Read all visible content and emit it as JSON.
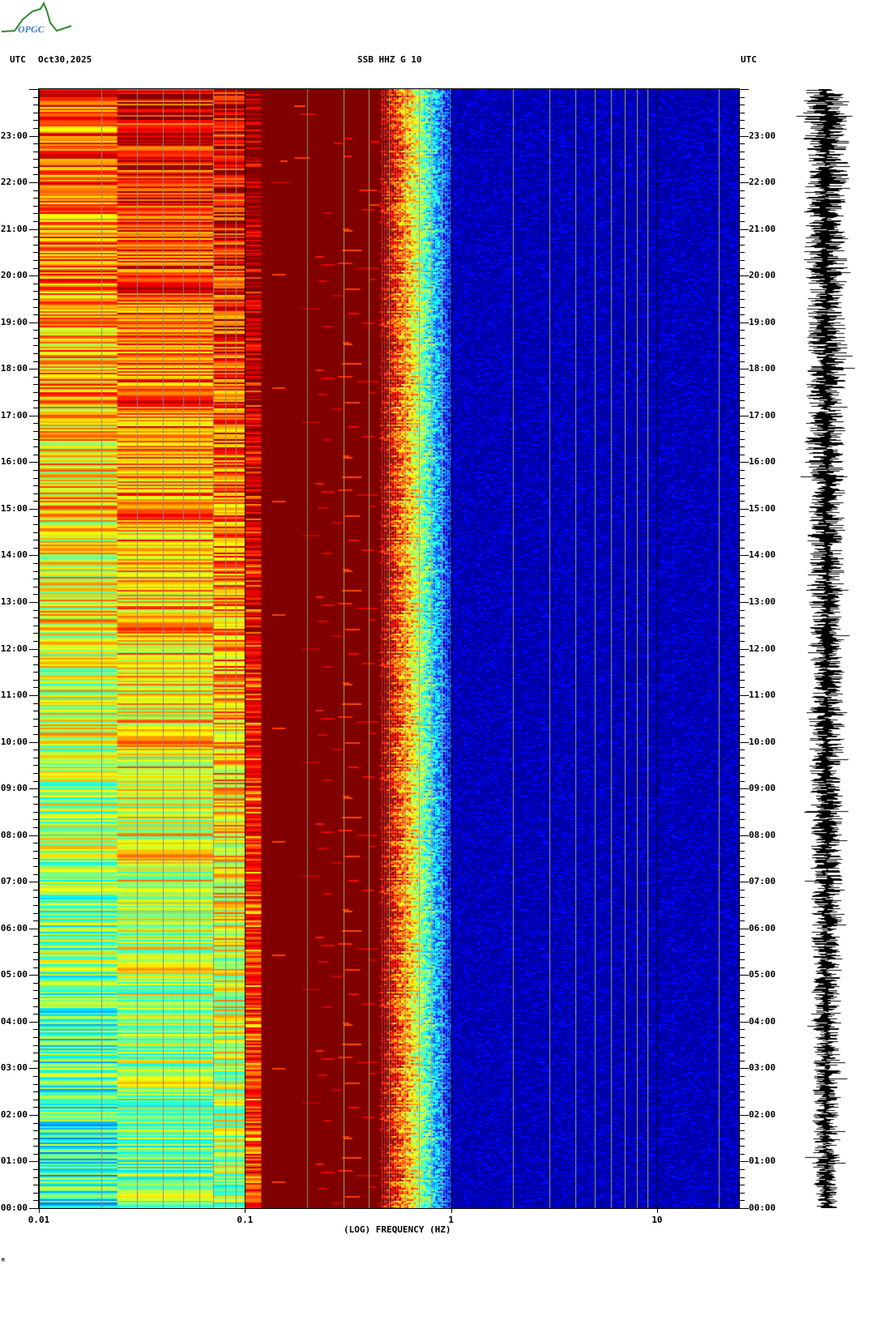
{
  "logo": {
    "text": "OPGC"
  },
  "header": {
    "left_tz": "UTC",
    "date": "Oct30,2025",
    "station": "SSB HHZ G 10",
    "right_tz": "UTC"
  },
  "footer_mark": "M",
  "chart_data": {
    "type": "heatmap",
    "title": "SSB HHZ G 10",
    "date": "Oct30,2025",
    "xlabel": "(LOG) FREQUENCY (HZ)",
    "ylabel": "UTC",
    "xscale": "log",
    "xlim": [
      0.01,
      25
    ],
    "xticks": [
      "0.01",
      "0.1",
      "1",
      "10"
    ],
    "xtick_values": [
      0.01,
      0.1,
      1,
      10
    ],
    "ylim_hours": [
      0,
      24
    ],
    "yticks": [
      "00:00",
      "01:00",
      "02:00",
      "03:00",
      "04:00",
      "05:00",
      "06:00",
      "07:00",
      "08:00",
      "09:00",
      "10:00",
      "11:00",
      "12:00",
      "13:00",
      "14:00",
      "15:00",
      "16:00",
      "17:00",
      "18:00",
      "19:00",
      "20:00",
      "21:00",
      "22:00",
      "23:00"
    ],
    "colormap": "jet",
    "description_bands_hz": [
      {
        "range": [
          0.01,
          0.1
        ],
        "level": "medium-high (cyan at 00h to orange at 23h)"
      },
      {
        "range": [
          0.1,
          0.12
        ],
        "level": "high"
      },
      {
        "range": [
          0.12,
          0.45
        ],
        "level": "max"
      },
      {
        "range": [
          0.45,
          1.0
        ],
        "level": "decreasing"
      },
      {
        "range": [
          1.0,
          25
        ],
        "level": "low"
      }
    ],
    "seismogram": "right-side trace, 24h"
  },
  "colors": {
    "max": "#800000",
    "low": "#0000a8",
    "grid": "#8a8a8a",
    "grid_hf": "#a8a860"
  }
}
